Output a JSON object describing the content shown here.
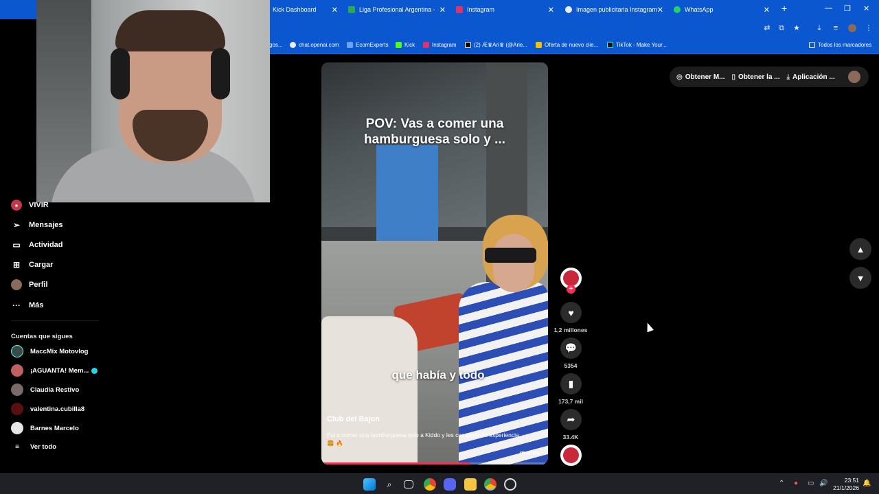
{
  "browser": {
    "tabs": [
      {
        "label": "Kick Dashboard",
        "color": "#53fc18"
      },
      {
        "label": "Liga Profesional Argentina - P...",
        "color": "#2fa84f"
      },
      {
        "label": "Instagram",
        "color": "#e1306c"
      },
      {
        "label": "Imagen publicitaria Instagram",
        "color": "#e8eefc"
      },
      {
        "label": "WhatsApp",
        "color": "#25d366"
      }
    ],
    "new_tab": "+",
    "bookmarks": [
      {
        "label": "gos...",
        "color": "#e8eefc"
      },
      {
        "label": "chat.openai.com",
        "color": "#e8eefc"
      },
      {
        "label": "EcomExperts",
        "color": "#6aa3ff"
      },
      {
        "label": "Kick",
        "color": "#53fc18"
      },
      {
        "label": "Instagram",
        "color": "#e1306c"
      },
      {
        "label": "(2) Æ♛Ari♛ (@Arie...",
        "color": "#000000"
      },
      {
        "label": "Oferta de nuevo clie...",
        "color": "#f2c200"
      },
      {
        "label": "TikTok - Make Your...",
        "color": "#111111"
      }
    ],
    "all_bookmarks": "Todos los marcadores"
  },
  "sidebar": {
    "items": [
      {
        "label": "VIVIR",
        "icon": "live-icon"
      },
      {
        "label": "Mensajes",
        "icon": "send-icon"
      },
      {
        "label": "Actividad",
        "icon": "activity-icon"
      },
      {
        "label": "Cargar",
        "icon": "upload-icon"
      },
      {
        "label": "Perfil",
        "icon": "profile-icon"
      },
      {
        "label": "Más",
        "icon": "more-icon"
      }
    ],
    "following_title": "Cuentas que sigues",
    "following": [
      {
        "name": "MaccMix Motovlog",
        "color": "#3b4a4f"
      },
      {
        "name": "¡AGUANTA! Mem...",
        "color": "#c06060",
        "verified": true
      },
      {
        "name": "Claudia Restivo",
        "color": "#7a6a6a"
      },
      {
        "name": "valentina.cubilla8",
        "color": "#5a1010"
      },
      {
        "name": "Barnes Marcelo",
        "color": "#e6e6e6"
      }
    ],
    "see_all": "Ver todo"
  },
  "video": {
    "caption": "POV: Vas a comer una hamburguesa solo y ...",
    "subtitle": "que había y todo",
    "author": "Club del Bajon",
    "description": "Fui a comer una hamburguesa solo a Kiddo y les comparto mi experiencia 🍔 🔥",
    "less": "menos",
    "progress": 0.66
  },
  "actions": {
    "likes": "1,2 millones",
    "comments": "5354",
    "saves": "173,7 mil",
    "shares": "33.4K"
  },
  "top_bar": {
    "get_m": "Obtener M...",
    "get_app": "Obtener la ...",
    "app": "Aplicación ..."
  },
  "taskbar": {
    "time": "23:51",
    "date": "21/1/2026"
  },
  "colors": {
    "tiktok_red": "#fe2c55",
    "chrome_blue": "#0b57d0"
  }
}
